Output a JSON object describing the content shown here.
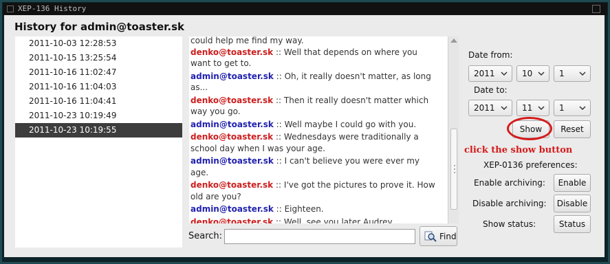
{
  "window": {
    "title": "XEP-136 History",
    "heading": "History for admin@toaster.sk"
  },
  "dates": [
    {
      "label": "2011-10-03 12:28:53",
      "selected": false
    },
    {
      "label": "2011-10-15 13:25:54",
      "selected": false
    },
    {
      "label": "2011-10-16 11:02:47",
      "selected": false
    },
    {
      "label": "2011-10-16 11:04:03",
      "selected": false
    },
    {
      "label": "2011-10-16 11:04:41",
      "selected": false
    },
    {
      "label": "2011-10-23 10:19:49",
      "selected": false
    },
    {
      "label": "2011-10-23 10:19:55",
      "selected": true
    }
  ],
  "chat": {
    "separator": "::",
    "lead_text": "could help me find my way.",
    "messages": [
      {
        "sender": "denko@toaster.sk",
        "role": "denko",
        "text": "Well that depends on where you want to get to."
      },
      {
        "sender": "admin@toaster.sk",
        "role": "admin",
        "text": "Oh, it really doesn't matter, as long as..."
      },
      {
        "sender": "denko@toaster.sk",
        "role": "denko",
        "text": "Then it really doesn't matter which way you go."
      },
      {
        "sender": "admin@toaster.sk",
        "role": "admin",
        "text": "Well maybe I could go with you."
      },
      {
        "sender": "denko@toaster.sk",
        "role": "denko",
        "text": "Wednesdays were traditionally a school day when I was your age."
      },
      {
        "sender": "admin@toaster.sk",
        "role": "admin",
        "text": "I can't believe you were ever my age."
      },
      {
        "sender": "denko@toaster.sk",
        "role": "denko",
        "text": " I've got the pictures to prove it. How old are you?"
      },
      {
        "sender": "admin@toaster.sk",
        "role": "admin",
        "text": " Eighteen."
      },
      {
        "sender": "denko@toaster.sk",
        "role": "denko",
        "text": "Well, see you later Audrey."
      }
    ]
  },
  "search": {
    "label": "Search:",
    "value": "",
    "find_label": "Find"
  },
  "filter": {
    "date_from_label": "Date from:",
    "date_to_label": "Date to:",
    "from": {
      "year": "2011",
      "month": "10",
      "day": "1"
    },
    "to": {
      "year": "2011",
      "month": "11",
      "day": "1"
    },
    "show_label": "Show",
    "reset_label": "Reset"
  },
  "annotation": {
    "text": "click the show button",
    "color": "#d61a1a"
  },
  "prefs": {
    "heading": "XEP-0136 preferences:",
    "rows": [
      {
        "label": "Enable archiving:",
        "button": "Enable"
      },
      {
        "label": "Disable archiving:",
        "button": "Disable"
      },
      {
        "label": "Show status:",
        "button": "Status"
      }
    ]
  },
  "colors": {
    "admin": "#2222b0",
    "denko": "#cc1e1e",
    "selection": "#3d3d3d"
  }
}
